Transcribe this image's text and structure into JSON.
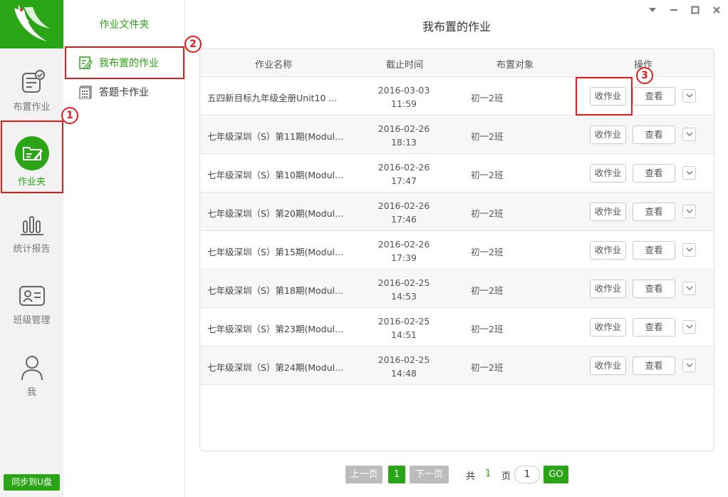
{
  "window": {
    "controls": [
      "dropdown-icon",
      "minimize-icon",
      "maximize-icon",
      "close-icon"
    ]
  },
  "nav": {
    "items": [
      {
        "label": "布置作业",
        "icon": "assign-icon"
      },
      {
        "label": "作业夹",
        "icon": "folder-edit-icon"
      },
      {
        "label": "统计报告",
        "icon": "chart-icon"
      },
      {
        "label": "班级管理",
        "icon": "contact-card-icon"
      },
      {
        "label": "我",
        "icon": "user-icon"
      }
    ],
    "sync_label": "同步到U盘"
  },
  "folder": {
    "title": "作业文件夹",
    "items": [
      {
        "label": "我布置的作业"
      },
      {
        "label": "答题卡作业"
      }
    ]
  },
  "main": {
    "title": "我布置的作业",
    "headers": {
      "name": "作业名称",
      "deadline": "截止时间",
      "target": "布置对象",
      "actions": "操作"
    },
    "collect_label": "收作业",
    "view_label": "查看",
    "rows": [
      {
        "name": "五四新目标九年级全册Unit10  ...",
        "date": "2016-03-03",
        "time": "11:59",
        "target": "初一2班"
      },
      {
        "name": "七年级深圳（S）第11期(Modul...",
        "date": "2016-02-26",
        "time": "18:13",
        "target": "初一2班"
      },
      {
        "name": "七年级深圳（S）第10期(Modul...",
        "date": "2016-02-26",
        "time": "17:47",
        "target": "初一2班"
      },
      {
        "name": "七年级深圳（S）第20期(Modul...",
        "date": "2016-02-26",
        "time": "17:46",
        "target": "初一2班"
      },
      {
        "name": "七年级深圳（S）第15期(Modul...",
        "date": "2016-02-26",
        "time": "17:39",
        "target": "初一2班"
      },
      {
        "name": "七年级深圳（S）第18期(Modul...",
        "date": "2016-02-25",
        "time": "14:53",
        "target": "初一2班"
      },
      {
        "name": "七年级深圳（S）第23期(Modul...",
        "date": "2016-02-25",
        "time": "14:51",
        "target": "初一2班"
      },
      {
        "name": "七年级深圳（S）第24期(Modul...",
        "date": "2016-02-25",
        "time": "14:48",
        "target": "初一2班"
      }
    ]
  },
  "pager": {
    "prev": "上一页",
    "current": "1",
    "next": "下一页",
    "total_prefix": "共",
    "total_pages": "1",
    "total_suffix": "页",
    "input_value": "1",
    "go": "GO"
  },
  "annotations": [
    "1",
    "2",
    "3"
  ],
  "colors": {
    "accent": "#2aa515",
    "annotation": "#dd1c1c",
    "disabled": "#bcbcbc"
  }
}
